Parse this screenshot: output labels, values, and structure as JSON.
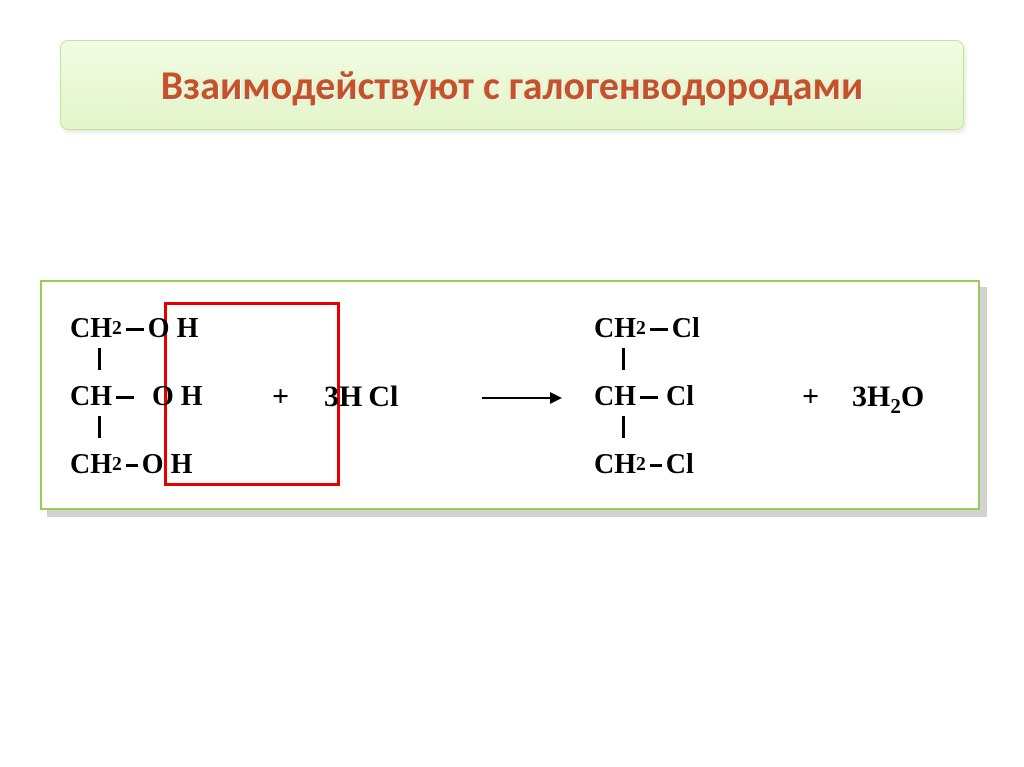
{
  "title": "Взаимодействуют с галогенводородами",
  "reaction": {
    "reactant_glycerol_rows": [
      {
        "carbon": "CH",
        "carbon_sub": "2",
        "right": "O H"
      },
      {
        "carbon": "CH",
        "carbon_sub": "",
        "right": "O H"
      },
      {
        "carbon": "CH",
        "carbon_sub": "2",
        "right": "O H"
      }
    ],
    "plus1": "+",
    "hcl_coeff": "3H",
    "hcl_rest": "Cl",
    "arrow": "→",
    "product_rows": [
      {
        "carbon": "CH",
        "carbon_sub": "2",
        "right": "Cl"
      },
      {
        "carbon": "CH",
        "carbon_sub": "",
        "right": "Cl"
      },
      {
        "carbon": "CH",
        "carbon_sub": "2",
        "right": "Cl"
      }
    ],
    "plus2": "+",
    "water_coeff": "3H",
    "water_sub": "2",
    "water_rest": "O"
  }
}
